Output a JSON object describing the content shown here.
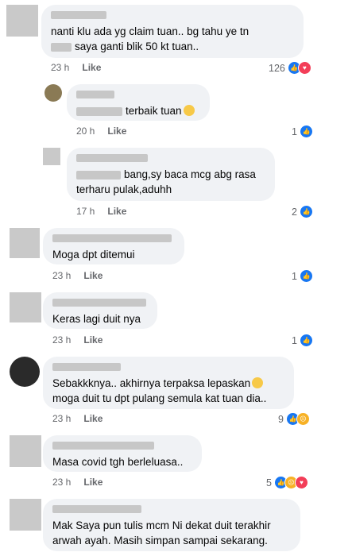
{
  "comments": [
    {
      "text": "nanti klu ada yg claim tuan.. bg tahu ye tn",
      "text2": "saya ganti blik 50 kt tuan..",
      "time": "23 h",
      "like": "Like",
      "reactions": "126"
    },
    {
      "text": "terbaik tuan",
      "time": "20 h",
      "like": "Like",
      "reactions": "1",
      "emoji": "thumbs-up"
    },
    {
      "text": "bang,sy baca mcg abg rasa",
      "text2": "terharu pulak,aduhh",
      "time": "17 h",
      "like": "Like",
      "reactions": "2"
    },
    {
      "text": "Moga dpt ditemui",
      "time": "23 h",
      "like": "Like",
      "reactions": "1"
    },
    {
      "text": "Keras lagi duit nya",
      "time": "23 h",
      "like": "Like",
      "reactions": "1"
    },
    {
      "text": "Sebakkknya.. akhirnya terpaksa lepaskan",
      "text2": "moga duit tu dpt pulang semula kat tuan dia..",
      "time": "23 h",
      "like": "Like",
      "reactions": "9"
    },
    {
      "text": "Masa covid tgh berleluasa..",
      "time": "23 h",
      "like": "Like",
      "reactions": "5"
    },
    {
      "text": "Mak Saya pun tulis mcm Ni  dekat duit terakhir",
      "text2": "arwah ayah. Masih simpan sampai sekarang."
    }
  ]
}
